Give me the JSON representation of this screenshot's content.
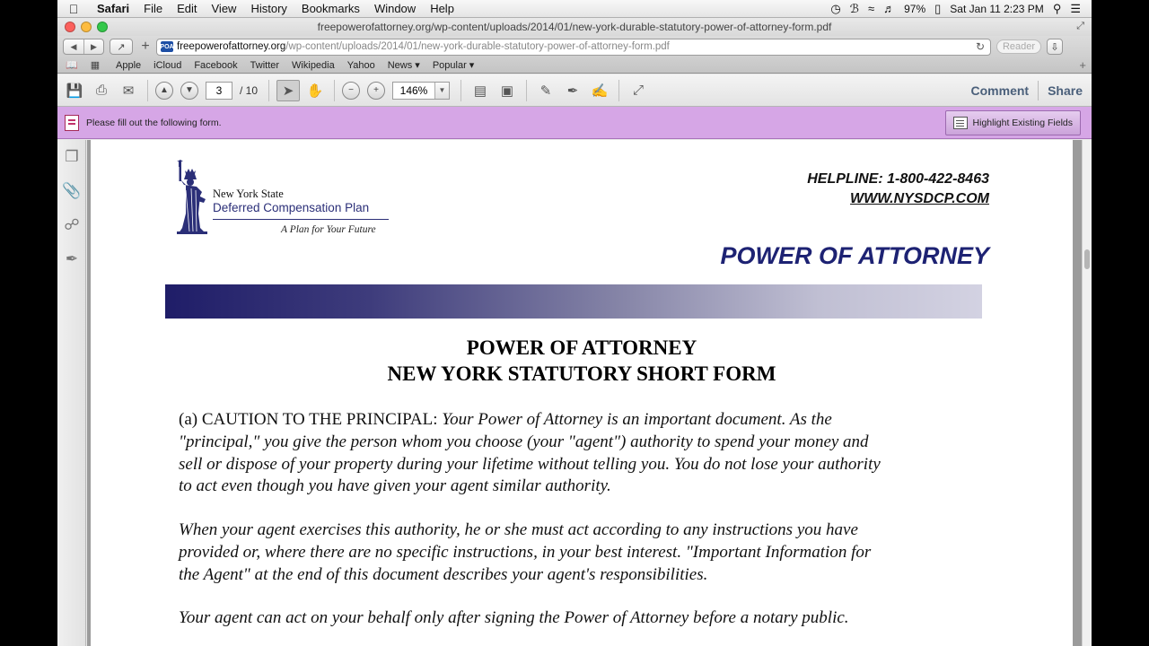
{
  "menubar": {
    "app": "Safari",
    "items": [
      "File",
      "Edit",
      "View",
      "History",
      "Bookmarks",
      "Window",
      "Help"
    ],
    "battery": "97%",
    "datetime": "Sat Jan 11  2:23 PM"
  },
  "window": {
    "title": "freepowerofattorney.org/wp-content/uploads/2014/01/new-york-durable-statutory-power-of-attorney-form.pdf"
  },
  "address": {
    "favicon_text": "POA",
    "domain": "freepowerofattorney.org",
    "path": "/wp-content/uploads/2014/01/new-york-durable-statutory-power-of-attorney-form.pdf",
    "reader": "Reader"
  },
  "bookmarks": [
    "Apple",
    "iCloud",
    "Facebook",
    "Twitter",
    "Wikipedia",
    "Yahoo",
    "News ▾",
    "Popular ▾"
  ],
  "pdf_toolbar": {
    "current_page": "3",
    "total_pages": "/  10",
    "zoom": "146%",
    "comment": "Comment",
    "share": "Share"
  },
  "form_bar": {
    "message": "Please fill out the following form.",
    "highlight_button": "Highlight Existing Fields"
  },
  "document": {
    "logo_line1": "New York State",
    "logo_line2": "Deferred Compensation Plan",
    "logo_tagline": "A Plan for Your Future",
    "helpline": "HELPLINE: 1-800-422-8463",
    "website": "WWW.NYSDCP.COM",
    "header_title": "POWER OF ATTORNEY",
    "form_title_1": "POWER OF ATTORNEY",
    "form_title_2": "NEW YORK STATUTORY SHORT FORM",
    "p1_lead": "(a)  CAUTION TO THE PRINCIPAL: ",
    "p1_line1": "Your Power of Attorney is an important document.  As the",
    "p1_line2": "\"principal,\" you give the person whom you choose (your \"agent\") authority to spend your money and",
    "p1_line3": "sell or dispose of your property during your lifetime without telling you.  You do not lose your authority",
    "p1_line4": "to act even though you have given your agent similar authority.",
    "p2_line1": "When your agent exercises this authority, he or she must act according to any instructions you have",
    "p2_line2": "provided or, where there are no specific instructions, in your best interest.  \"Important Information for",
    "p2_line3": "the Agent\" at the end of this document describes your agent's responsibilities.",
    "p3_line1": "Your agent can act on your behalf only after signing the Power of Attorney before a notary public."
  },
  "colors": {
    "form_bar": "#d6a6e6",
    "header_blue": "#1d2273",
    "banner_dark": "#1f1d68"
  }
}
